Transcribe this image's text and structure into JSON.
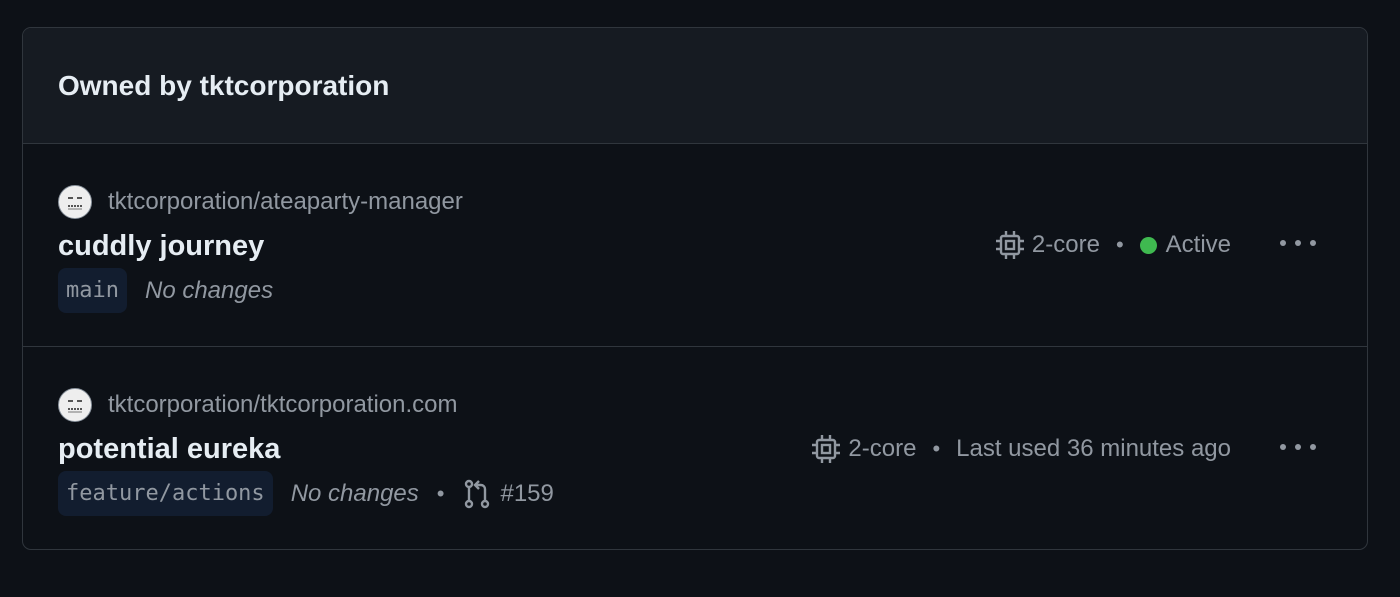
{
  "panel": {
    "title": "Owned by tktcorporation"
  },
  "codespaces": [
    {
      "repo": "tktcorporation/ateaparty-manager",
      "name": "cuddly journey",
      "branch": "main",
      "changes": "No changes",
      "machine": "2-core",
      "separator": "•",
      "status": "Active",
      "status_color": "#3fb950"
    },
    {
      "repo": "tktcorporation/tktcorporation.com",
      "name": "potential eureka",
      "branch": "feature/actions",
      "changes": "No changes",
      "pr_separator": "•",
      "pr": "#159",
      "machine": "2-core",
      "separator": "•",
      "last_used": "Last used 36 minutes ago"
    }
  ],
  "icons": {
    "avatar": "avatar-icon",
    "cpu": "cpu-icon",
    "pull_request": "git-pull-request-icon",
    "more": "kebab-horizontal-icon"
  },
  "colors": {
    "background": "#0d1117",
    "header_bg": "#161b22",
    "border": "#30363d",
    "text_primary": "#e6edf3",
    "text_muted": "#9198a1",
    "branch_bg": "#121d2f"
  }
}
